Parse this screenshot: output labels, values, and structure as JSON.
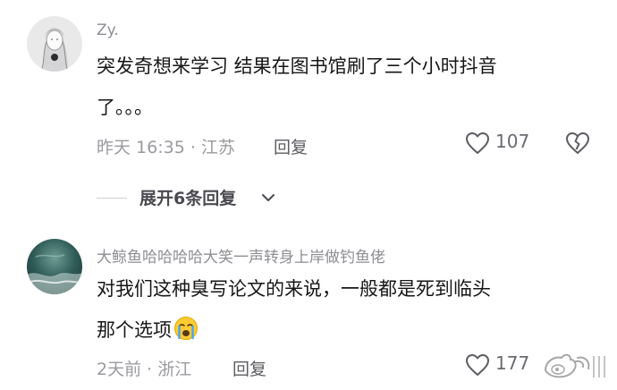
{
  "comments": [
    {
      "author": "Zy.",
      "text_lines": [
        "突发奇想来学习 结果在图书馆刷了三个小时抖音",
        "了。。。"
      ],
      "meta": "昨天 16:35 · 江苏",
      "reply_label": "回复",
      "likes": "107"
    },
    {
      "author": "大鲸鱼哈哈哈哈大笑一声转身上岸做钓鱼佬",
      "text_lines": [
        "对我们这种臭写论文的来说，一般都是死到临头",
        "那个选项"
      ],
      "meta": "2天前 · 浙江",
      "reply_label": "回复",
      "likes": "177"
    }
  ],
  "expand_replies": {
    "label": "展开6条回复"
  },
  "icons": {
    "like": "heart-outline-icon",
    "dislike": "broken-heart-icon",
    "expand": "chevron-down-icon",
    "emoji": "crying-face-emoji",
    "watermark": "weibo-watermark"
  },
  "colors": {
    "background": "#ffffff",
    "text": "#161616",
    "secondary": "#9a9a9f",
    "icon": "#5c5c62"
  }
}
